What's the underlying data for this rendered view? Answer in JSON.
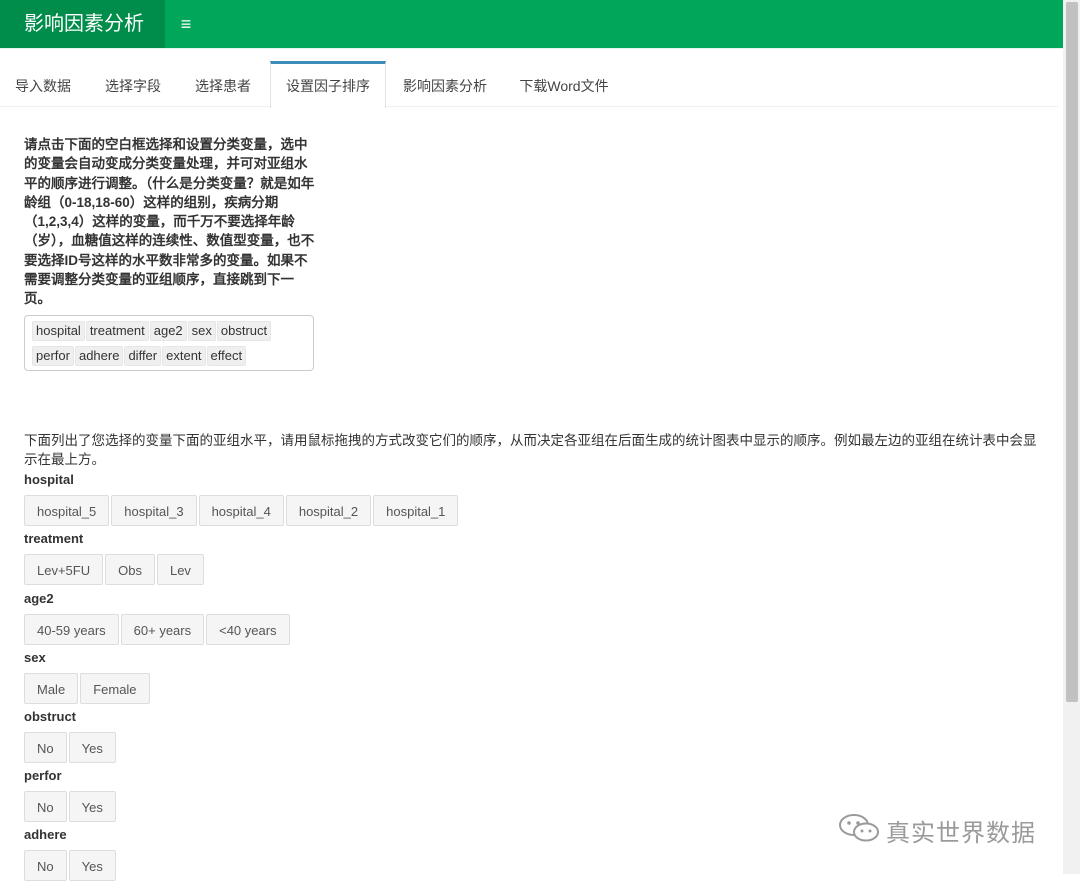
{
  "app": {
    "title": "影响因素分析",
    "menu_icon": "≡"
  },
  "tabs": [
    {
      "label": "导入数据"
    },
    {
      "label": "选择字段"
    },
    {
      "label": "选择患者"
    },
    {
      "label": "设置因子排序"
    },
    {
      "label": "影响因素分析"
    },
    {
      "label": "下载Word文件"
    }
  ],
  "active_tab": "设置因子排序",
  "instructions": "请点击下面的空白框选择和设置分类变量，选中的变量会自动变成分类变量处理，并可对亚组水平的顺序进行调整。（什么是分类变量？就是如年龄组（0-18,18-60）这样的组别，疾病分期（1,2,3,4）这样的变量，而千万不要选择年龄（岁），血糖值这样的连续性、数值型变量，也不要选择ID号这样的水平数非常多的变量。如果不需要调整分类变量的亚组顺序，直接跳到下一页。",
  "selected_vars": [
    "hospital",
    "treatment",
    "age2",
    "sex",
    "obstruct",
    "perfor",
    "adhere",
    "differ",
    "extent",
    "effect"
  ],
  "description": "下面列出了您选择的变量下面的亚组水平，请用鼠标拖拽的方式改变它们的顺序，从而决定各亚组在后面生成的统计图表中显示的顺序。例如最左边的亚组在统计表中会显示在最上方。",
  "variables": [
    {
      "name": "hospital",
      "levels": [
        "hospital_5",
        "hospital_3",
        "hospital_4",
        "hospital_2",
        "hospital_1"
      ]
    },
    {
      "name": "treatment",
      "levels": [
        "Lev+5FU",
        "Obs",
        "Lev"
      ]
    },
    {
      "name": "age2",
      "levels": [
        "40-59 years",
        "60+ years",
        "<40 years"
      ]
    },
    {
      "name": "sex",
      "levels": [
        "Male",
        "Female"
      ]
    },
    {
      "name": "obstruct",
      "levels": [
        "No",
        "Yes"
      ]
    },
    {
      "name": "perfor",
      "levels": [
        "No",
        "Yes"
      ]
    },
    {
      "name": "adhere",
      "levels": [
        "No",
        "Yes"
      ]
    }
  ],
  "watermark": {
    "text": "真实世界数据",
    "icon": "wechat-icon"
  },
  "colors": {
    "header": "#00a65a",
    "brand_bg": "#008d4c",
    "active_tab_border": "#3c8dbc"
  }
}
